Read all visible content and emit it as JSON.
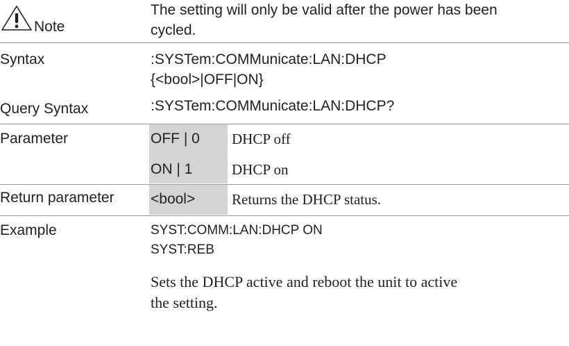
{
  "note": {
    "label": "Note",
    "text_line1": "The setting will only be valid after the power has been",
    "text_line2": "cycled.",
    "icon": "warning-triangle-icon"
  },
  "syntax": {
    "label": "Syntax",
    "line1": ":SYSTem:COMMunicate:LAN:DHCP",
    "line2": "{<bool>|OFF|ON}"
  },
  "query_syntax": {
    "label": "Query Syntax",
    "value": ":SYSTem:COMMunicate:LAN:DHCP?"
  },
  "parameter": {
    "label": "Parameter",
    "rows": [
      {
        "key": "OFF | 0",
        "desc": "DHCP off"
      },
      {
        "key": "ON | 1",
        "desc": "DHCP on"
      }
    ]
  },
  "return_parameter": {
    "label": "Return parameter",
    "key": "<bool>",
    "desc": "Returns the DHCP status."
  },
  "example": {
    "label": "Example",
    "cmd1": "SYST:COMM:LAN:DHCP ON",
    "cmd2": "SYST:REB",
    "desc_line1": "Sets the DHCP active and reboot the unit to active",
    "desc_line2": "the setting."
  },
  "colors": {
    "divider": "#9a9a9a",
    "shade": "#d4d4d4",
    "text": "#231f20"
  }
}
